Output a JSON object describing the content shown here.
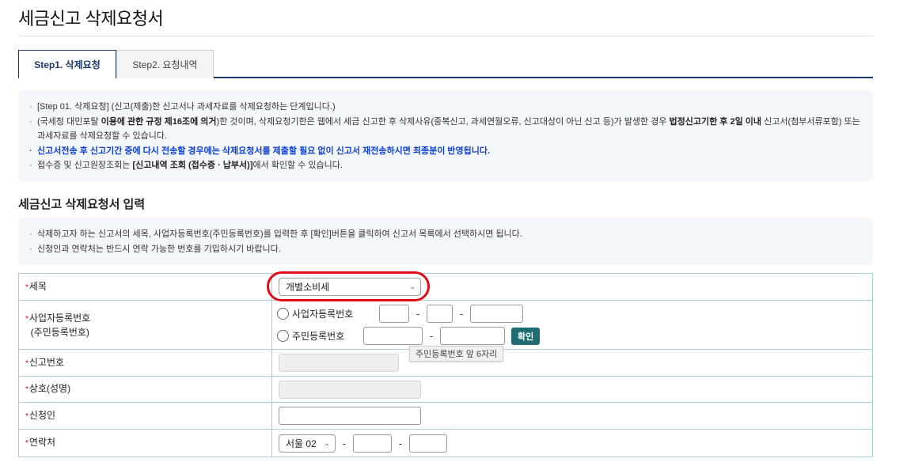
{
  "page": {
    "title": "세금신고 삭제요청서"
  },
  "tabs": [
    {
      "label": "Step1. 삭제요청",
      "active": true
    },
    {
      "label": "Step2. 요청내역",
      "active": false
    }
  ],
  "info": {
    "line1": "[Step 01. 삭제요청] (신고(제출)한 신고서나 과세자료를 삭제요청하는 단계입니다.)",
    "line2_a": "(국세청 대민포탈 ",
    "line2_b": "이용에 관한 규정 제16조에 의거",
    "line2_c": ")한 것이며, 삭제요청기한은 웹에서 세금 신고한 후 삭제사유(중복신고, 과세연월오류, 신고대상이 아닌 신고 등)가 발생한 경우 ",
    "line2_d": "법정신고기한 후 2일 이내",
    "line2_e": " 신고서(첨부서류포함) 또는",
    "line2_f": "과세자료를 삭제요청할 수 있습니다.",
    "line3": "신고서전송 후 신고기간 중에 다시 전송할 경우에는 삭제요청서를 제출할 필요 없이 신고서 재전송하시면 최종분이 반영됩니다.",
    "line4_a": "접수증 및 신고원장조회는 ",
    "line4_b": "[신고내역 조회 (접수증 · 납부서)]",
    "line4_c": "에서 확인할 수 있습니다."
  },
  "section": {
    "title": "세금신고 삭제요청서 입력"
  },
  "guide": {
    "line1": "삭제하고자 하는 신고서의 세목, 사업자등록번호(주민등록번호)를 입력한 후 [확인]버튼을 클릭하여 신고서 목록에서 선택하시면 됩니다.",
    "line2": "신청인과 연락처는 반드시 연락 가능한 번호를 기입하시기 바랍니다."
  },
  "form": {
    "required_mark": "*",
    "tax_type": {
      "label": "세목",
      "value": "개별소비세"
    },
    "biz_no": {
      "label_line1": "사업자등록번호",
      "label_line2": "(주민등록번호)",
      "radio_biz": "사업자등록번호",
      "radio_resident": "주민등록번호",
      "confirm_label": "확인",
      "tooltip": "주민등록번호 앞 6자리"
    },
    "report_no": {
      "label": "신고번호"
    },
    "company_name": {
      "label": "상호(성명)"
    },
    "applicant": {
      "label": "신청인"
    },
    "contact": {
      "label": "연락처",
      "area_code": "서울 02"
    },
    "dash": "-"
  },
  "colors": {
    "accent": "#1b3a6b",
    "confirm_button": "#1f6d72",
    "highlight": "#e10a16",
    "notice_blue": "#0b3fd6"
  }
}
